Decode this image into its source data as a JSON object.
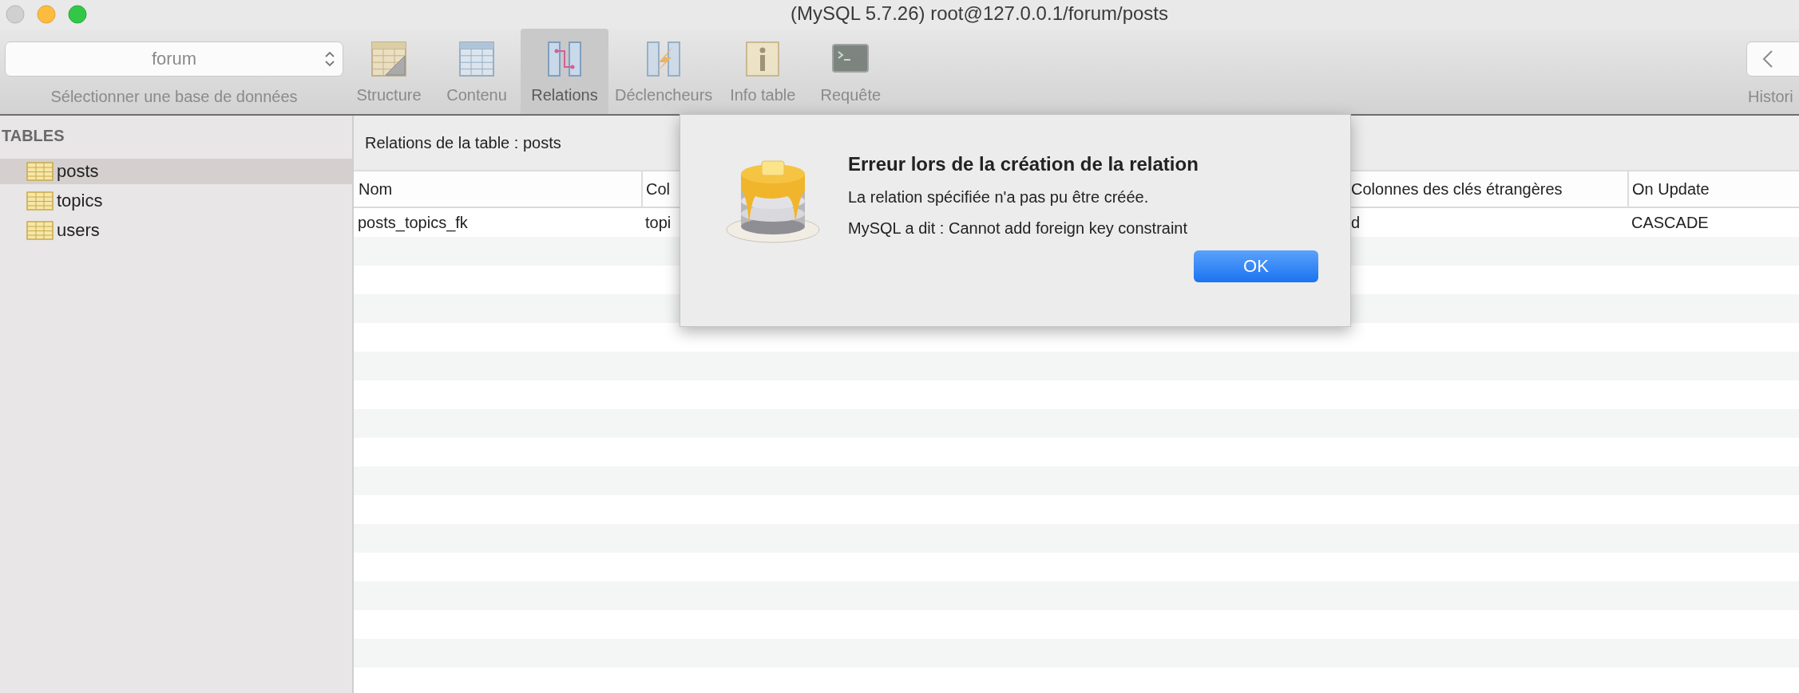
{
  "window": {
    "title": "(MySQL 5.7.26) root@127.0.0.1/forum/posts"
  },
  "toolbar": {
    "database_select": {
      "value": "forum",
      "label": "Sélectionner une base de données"
    },
    "items": [
      {
        "kind": "structure",
        "label": "Structure",
        "selected": false
      },
      {
        "kind": "content",
        "label": "Contenu",
        "selected": false
      },
      {
        "kind": "relations",
        "label": "Relations",
        "selected": true
      },
      {
        "kind": "triggers",
        "label": "Déclencheurs",
        "selected": false
      },
      {
        "kind": "info",
        "label": "Info table",
        "selected": false
      },
      {
        "kind": "query",
        "label": "Requête",
        "selected": false
      }
    ],
    "history": {
      "label": "Histori"
    }
  },
  "sidebar": {
    "header": "TABLES",
    "items": [
      {
        "label": "posts",
        "selected": true
      },
      {
        "label": "topics",
        "selected": false
      },
      {
        "label": "users",
        "selected": false
      }
    ]
  },
  "content": {
    "title": "Relations de la table : posts",
    "table": {
      "columns": [
        "Nom",
        "Col",
        "Colonnes des clés étrangères",
        "On Update"
      ],
      "rows": [
        [
          "posts_topics_fk",
          "topi",
          "d",
          "CASCADE"
        ]
      ]
    }
  },
  "dialog": {
    "title": "Erreur lors de la création de la relation",
    "message": "La relation spécifiée n'a pas pu être créée.",
    "detail": "MySQL a dit : Cannot add foreign key constraint",
    "buttons": [
      {
        "label": "OK"
      }
    ]
  }
}
